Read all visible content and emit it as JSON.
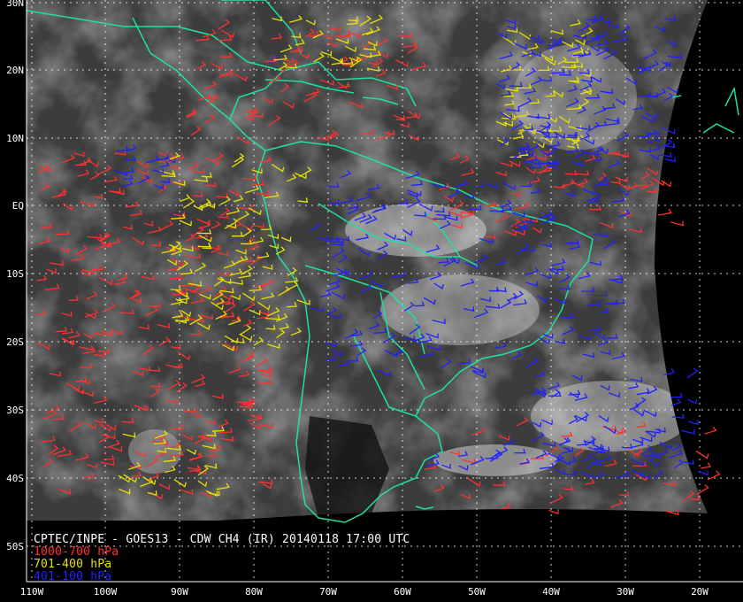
{
  "map": {
    "caption_title": "CPTEC/INPE - GOES13 - CDW CH4 (IR) 20140118 17:00 UTC",
    "legend": [
      {
        "label": "1000-700 hPa",
        "color": "#ff3030"
      },
      {
        "label": "701-400 hPa",
        "color": "#e8e000"
      },
      {
        "label": "401-100 hPa",
        "color": "#2020ff"
      }
    ],
    "lat_labels": [
      "30N",
      "20N",
      "10N",
      "EQ",
      "10S",
      "20S",
      "30S",
      "40S",
      "50S"
    ],
    "lon_labels": [
      "110W",
      "100W",
      "90W",
      "80W",
      "70W",
      "60W",
      "50W",
      "40W",
      "30W",
      "20W"
    ],
    "coastline_color": "#20e0a0",
    "grid_color": "#ffffff",
    "background_color": "#000000"
  }
}
